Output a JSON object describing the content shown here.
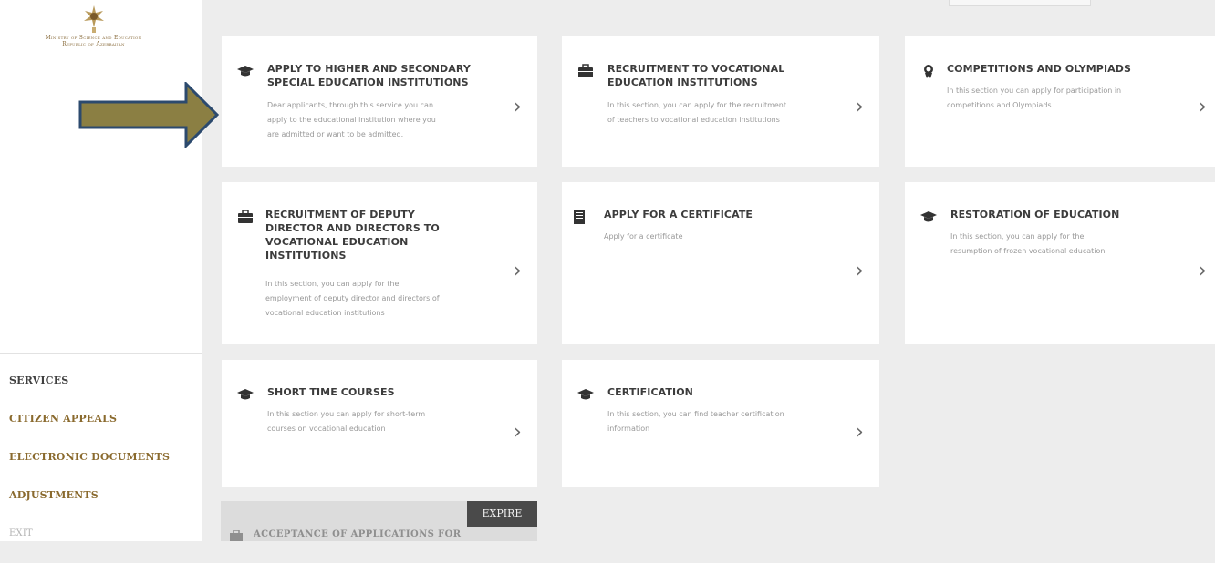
{
  "ministry": {
    "line1": "Ministry of Science and Education",
    "line2": "Republic of Azerbaijan"
  },
  "sidebar": {
    "items": [
      {
        "label": "SERVICES"
      },
      {
        "label": "CITIZEN APPEALS"
      },
      {
        "label": "ELECTRONIC DOCUMENTS"
      },
      {
        "label": "ADJUSTMENTS"
      },
      {
        "label": "EXIT"
      }
    ]
  },
  "cards": [
    {
      "icon": "graduation-cap-icon",
      "title1": "APPLY TO HIGHER AND SECONDARY",
      "title2": "SPECIAL EDUCATION INSTITUTIONS",
      "desc1": "Dear applicants, through this service you can",
      "desc2": "apply to the educational institution where you",
      "desc3": "are admitted or want to be admitted."
    },
    {
      "icon": "briefcase-icon",
      "title1": "RECRUITMENT TO VOCATIONAL",
      "title2": "EDUCATION INSTITUTIONS",
      "desc1": "In this section, you can apply for the recruitment",
      "desc2": "of teachers to vocational education institutions"
    },
    {
      "icon": "medal-icon",
      "title1": "COMPETITIONS AND OLYMPIADS",
      "desc1": "In this section you can apply for participation in",
      "desc2": "competitions and Olympiads"
    },
    {
      "icon": "briefcase-icon",
      "title1": "RECRUITMENT OF DEPUTY",
      "title2": "DIRECTOR AND DIRECTORS TO",
      "title3": "VOCATIONAL EDUCATION",
      "title4": "INSTITUTIONS",
      "desc1": "In this section, you can apply for the",
      "desc2": "employment of deputy director and directors of",
      "desc3": "vocational education institutions"
    },
    {
      "icon": "document-icon",
      "title1": "APPLY FOR A CERTIFICATE",
      "desc1": "Apply for a certificate"
    },
    {
      "icon": "graduation-cap-icon",
      "title1": "RESTORATION OF EDUCATION",
      "desc1": "In this section, you can apply for the",
      "desc2": "resumption of frozen vocational education"
    },
    {
      "icon": "graduation-cap-icon",
      "title1": "SHORT TIME COURSES",
      "desc1": "In this section you can apply for short-term",
      "desc2": "courses on vocational education"
    },
    {
      "icon": "graduation-cap-icon",
      "title1": "CERTIFICATION",
      "desc1": "In this section, you can find teacher certification",
      "desc2": "information"
    }
  ],
  "expire_card": {
    "badge": "EXPIRE",
    "title": "ACCEPTANCE OF APPLICATIONS FOR"
  },
  "colors": {
    "arrow_fill": "#8b7f43",
    "arrow_stroke": "#2c4a6e",
    "gold_text": "#8a6a2e"
  }
}
